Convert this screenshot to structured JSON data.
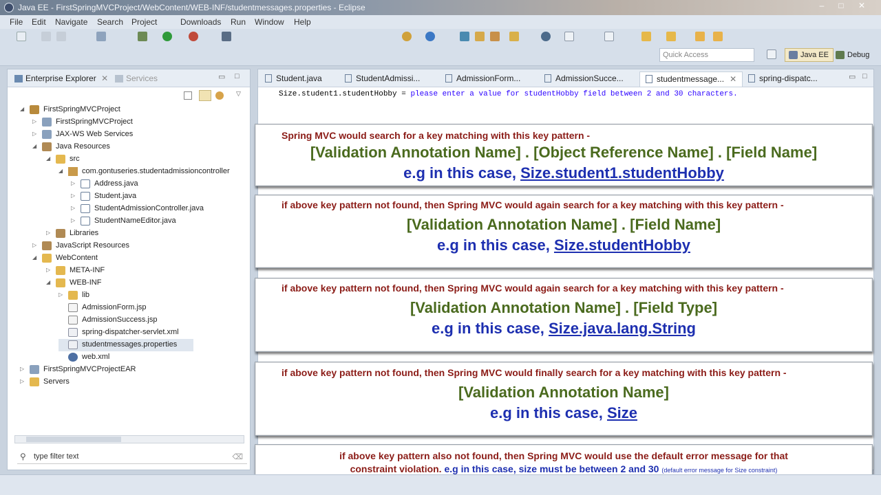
{
  "window": {
    "title": "Java EE - FirstSpringMVCProject/WebContent/WEB-INF/studentmessages.properties - Eclipse",
    "controls": [
      "–",
      "□",
      "✕"
    ]
  },
  "menu": [
    "File",
    "Edit",
    "Navigate",
    "Search",
    "Project",
    "Downloads",
    "Run",
    "Window",
    "Help"
  ],
  "toolbar": {
    "quick_access_placeholder": "Quick Access",
    "perspectives": [
      "Java EE",
      "Debug"
    ]
  },
  "explorer": {
    "tabs": [
      "Enterprise Explorer",
      "Services"
    ],
    "tree": [
      {
        "label": "FirstSpringMVCProject",
        "expanded": true,
        "icon": "project-icon"
      },
      {
        "label": "FirstSpringMVCProject",
        "expanded": false,
        "icon": "deployment-descriptor-icon"
      },
      {
        "label": "JAX-WS Web Services",
        "expanded": false,
        "icon": "webservices-icon"
      },
      {
        "label": "Java Resources",
        "expanded": true,
        "icon": "java-resources-icon"
      },
      {
        "label": "src",
        "expanded": true,
        "icon": "source-folder-icon"
      },
      {
        "label": "com.gontuseries.studentadmissioncontroller",
        "expanded": true,
        "icon": "package-icon"
      },
      {
        "label": "Address.java",
        "expanded": false,
        "icon": "java-file-icon"
      },
      {
        "label": "Student.java",
        "expanded": false,
        "icon": "java-file-icon"
      },
      {
        "label": "StudentAdmissionController.java",
        "expanded": false,
        "icon": "java-file-icon"
      },
      {
        "label": "StudentNameEditor.java",
        "expanded": false,
        "icon": "java-file-icon"
      },
      {
        "label": "Libraries",
        "expanded": false,
        "icon": "libraries-icon"
      },
      {
        "label": "JavaScript Resources",
        "expanded": false,
        "icon": "javascript-resources-icon"
      },
      {
        "label": "WebContent",
        "expanded": true,
        "icon": "folder-icon"
      },
      {
        "label": "META-INF",
        "expanded": false,
        "icon": "folder-icon"
      },
      {
        "label": "WEB-INF",
        "expanded": true,
        "icon": "folder-icon"
      },
      {
        "label": "lib",
        "expanded": false,
        "icon": "folder-icon"
      },
      {
        "label": "AdmissionForm.jsp",
        "icon": "jsp-file-icon"
      },
      {
        "label": "AdmissionSuccess.jsp",
        "icon": "jsp-file-icon"
      },
      {
        "label": "spring-dispatcher-servlet.xml",
        "icon": "xml-file-icon"
      },
      {
        "label": "studentmessages.properties",
        "icon": "properties-file-icon",
        "selected": true
      },
      {
        "label": "web.xml",
        "icon": "web-xml-icon"
      },
      {
        "label": "FirstSpringMVCProjectEAR",
        "expanded": false,
        "icon": "ear-project-icon"
      },
      {
        "label": "Servers",
        "expanded": false,
        "icon": "servers-icon"
      }
    ],
    "filter_placeholder": "type filter text"
  },
  "editor": {
    "tabs": [
      "Student.java",
      "StudentAdmissi...",
      "AdmissionForm...",
      "AdmissionSucce...",
      "studentmessage...",
      "spring-dispatc..."
    ],
    "active_tab": "studentmessage...",
    "code_key": "Size.student1.studentHobby =",
    "code_value": "please enter a value for studentHobby field between 2 and 30 characters."
  },
  "overlay": {
    "panel1": {
      "text": "Spring MVC would search for a key matching with this key pattern -",
      "pattern": "[Validation Annotation Name] . [Object Reference Name] . [Field Name]",
      "eg_prefix": "e.g in this case,",
      "eg_value": "Size.student1.studentHobby"
    },
    "panel2": {
      "text": "if above key pattern not found, then Spring MVC would again search for a key matching with this key pattern -",
      "pattern": "[Validation Annotation Name] . [Field Name]",
      "eg_prefix": "e.g in this case,",
      "eg_value": "Size.studentHobby"
    },
    "panel3": {
      "text": "if above key pattern not found, then Spring MVC would again search for a key matching with this key pattern -",
      "pattern": "[Validation Annotation Name] . [Field Type]",
      "eg_prefix": "e.g in this case,",
      "eg_value": "Size.java.lang.String"
    },
    "panel4": {
      "text": "if above key pattern not found, then Spring MVC would finally search for a key matching with this key pattern -",
      "pattern": "[Validation Annotation Name]",
      "eg_prefix": "e.g in this case,",
      "eg_value": "Size"
    },
    "panel5": {
      "line1": "if above key pattern also not found, then Spring MVC would use the default error message for that",
      "line2_red": "constraint violation.",
      "line2_blue": "e.g in this case, size must be between 2 and 30",
      "line2_small": "(default error message for Size constraint)"
    }
  }
}
